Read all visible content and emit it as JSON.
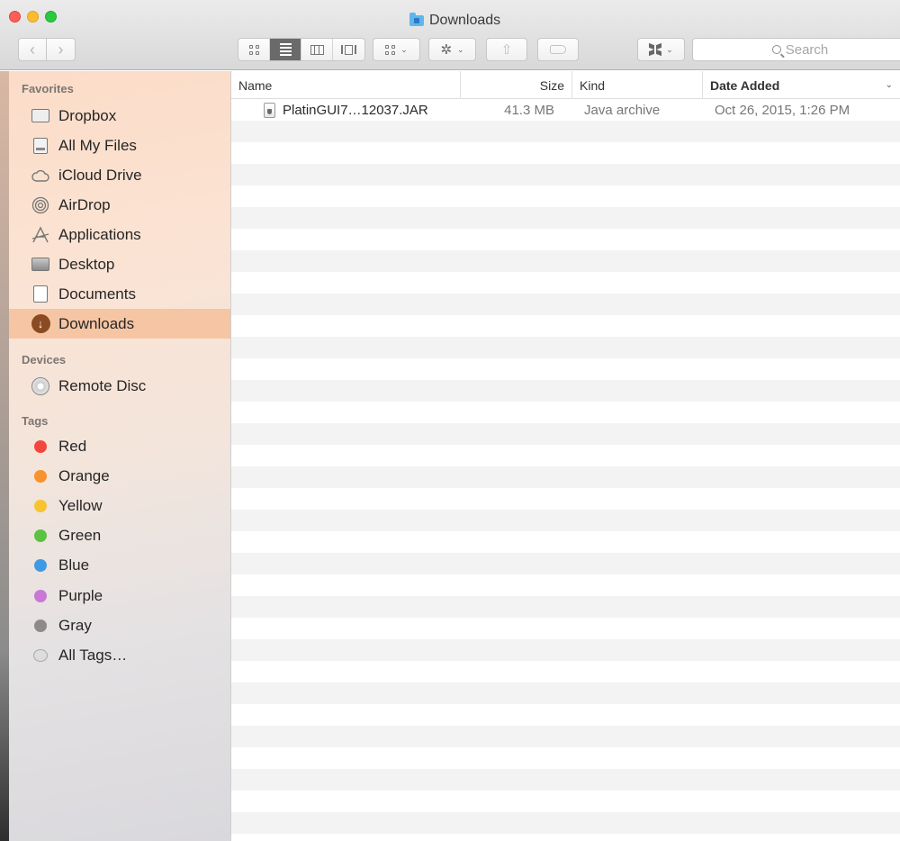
{
  "window": {
    "title": "Downloads"
  },
  "toolbar": {
    "back_glyph": "‹",
    "forward_glyph": "›",
    "caret": "⌄",
    "gear_glyph": "✲",
    "share_glyph": "⇧",
    "search_placeholder": "Search"
  },
  "sidebar": {
    "favorites_heading": "Favorites",
    "favorites": [
      {
        "label": "Dropbox",
        "icon": "folder-icon"
      },
      {
        "label": "All My Files",
        "icon": "all-files-icon"
      },
      {
        "label": "iCloud Drive",
        "icon": "cloud-icon"
      },
      {
        "label": "AirDrop",
        "icon": "airdrop-icon"
      },
      {
        "label": "Applications",
        "icon": "applications-icon"
      },
      {
        "label": "Desktop",
        "icon": "desktop-icon"
      },
      {
        "label": "Documents",
        "icon": "documents-icon"
      },
      {
        "label": "Downloads",
        "icon": "downloads-icon",
        "selected": true
      }
    ],
    "devices_heading": "Devices",
    "devices": [
      {
        "label": "Remote Disc",
        "icon": "disc-icon"
      }
    ],
    "tags_heading": "Tags",
    "tags": [
      {
        "label": "Red",
        "color": "#f2473f"
      },
      {
        "label": "Orange",
        "color": "#f7922e"
      },
      {
        "label": "Yellow",
        "color": "#f6c431"
      },
      {
        "label": "Green",
        "color": "#5ac33f"
      },
      {
        "label": "Blue",
        "color": "#3f9ae6"
      },
      {
        "label": "Purple",
        "color": "#c878d6"
      },
      {
        "label": "Gray",
        "color": "#8e8a8a"
      },
      {
        "label": "All Tags…",
        "color": ""
      }
    ],
    "selection_color": "#f6c5a3"
  },
  "file_list": {
    "columns": {
      "name": "Name",
      "size": "Size",
      "kind": "Kind",
      "date_added": "Date Added"
    },
    "sort_column": "Date Added",
    "rows": [
      {
        "name": "PlatinGUI7…12037.JAR",
        "size": "41.3 MB",
        "kind": "Java archive",
        "date_added": "Oct 26, 2015, 1:26 PM",
        "icon": "jar-file-icon"
      }
    ]
  }
}
